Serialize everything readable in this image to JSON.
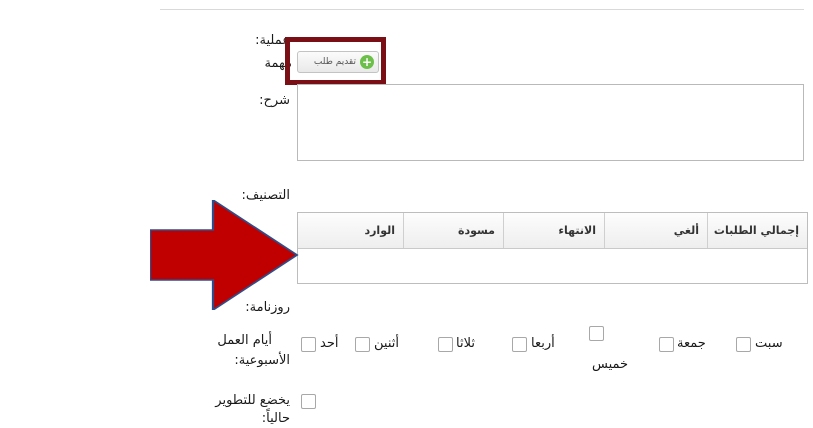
{
  "form": {
    "operation_label": ":عملية",
    "task_label": "مهمة",
    "submit_button_label": "تقديم طلب",
    "description_label": ":شرح",
    "classification_label": ":التصنيف",
    "calendar_label": ":روزنامة",
    "workdays_label_line1": "أيام العمل",
    "workdays_label_line2": ":الأسبوعية",
    "dev_label_line1": "يخضع للتطوير",
    "dev_label_line2": ":حالياً"
  },
  "classification_table": {
    "columns": [
      "إجمالي الطلبات",
      "ألغي",
      "الانتهاء",
      "مسودة",
      "الوارد"
    ]
  },
  "workdays": [
    "أحد",
    "أثنين",
    "ثلاثا",
    "أربعا",
    "خميس",
    "جمعة",
    "سبت"
  ],
  "colors": {
    "highlight": "#7a0f16",
    "arrow": "#c00000",
    "arrow_border": "#2f4d8a"
  }
}
